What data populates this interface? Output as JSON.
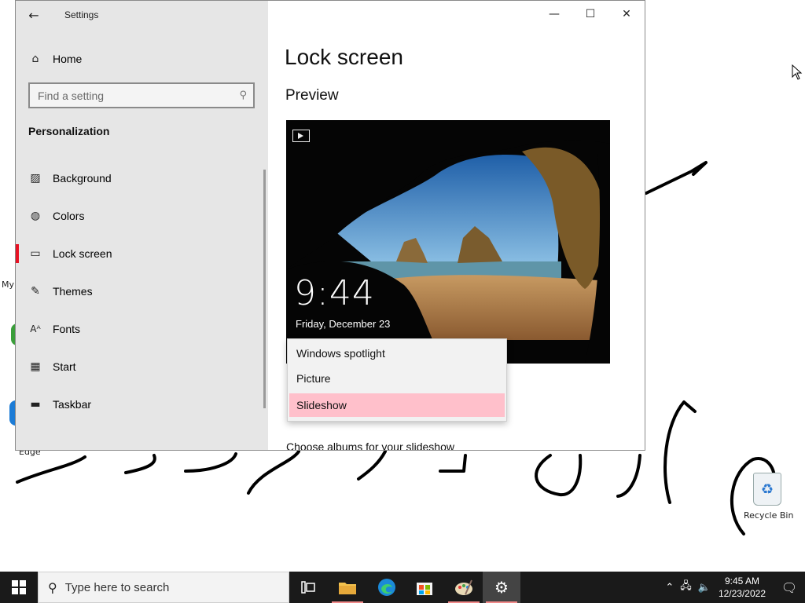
{
  "window": {
    "app_title": "Settings",
    "controls": {
      "minimize": "—",
      "maximize": "☐",
      "close": "✕"
    }
  },
  "sidebar": {
    "home_label": "Home",
    "search_placeholder": "Find a setting",
    "section_title": "Personalization",
    "items": [
      {
        "label": "Background",
        "icon": "picture-icon"
      },
      {
        "label": "Colors",
        "icon": "palette-icon"
      },
      {
        "label": "Lock screen",
        "icon": "lock-screen-icon",
        "active": true
      },
      {
        "label": "Themes",
        "icon": "themes-icon"
      },
      {
        "label": "Fonts",
        "icon": "fonts-icon"
      },
      {
        "label": "Start",
        "icon": "start-icon"
      },
      {
        "label": "Taskbar",
        "icon": "taskbar-icon"
      }
    ]
  },
  "main": {
    "page_title": "Lock screen",
    "preview_label": "Preview",
    "lock_time": "9:44",
    "lock_date": "Friday, December 23",
    "background_dropdown": {
      "options": [
        "Windows spotlight",
        "Picture",
        "Slideshow"
      ],
      "selected": "Slideshow"
    },
    "albums_label": "Choose albums for your slideshow"
  },
  "desktop": {
    "icon_label_my": "My",
    "icon_label_edge": "Edge",
    "recycle_bin_label": "Recycle Bin"
  },
  "taskbar": {
    "search_placeholder": "Type here to search",
    "apps": [
      "task-view",
      "file-explorer",
      "edge",
      "store",
      "paint",
      "settings"
    ],
    "time": "9:45 AM",
    "date": "12/23/2022"
  },
  "colors": {
    "accent_red": "#e81123",
    "dropdown_selected": "#ffc0cb",
    "taskbar": "#1a1a1a"
  }
}
